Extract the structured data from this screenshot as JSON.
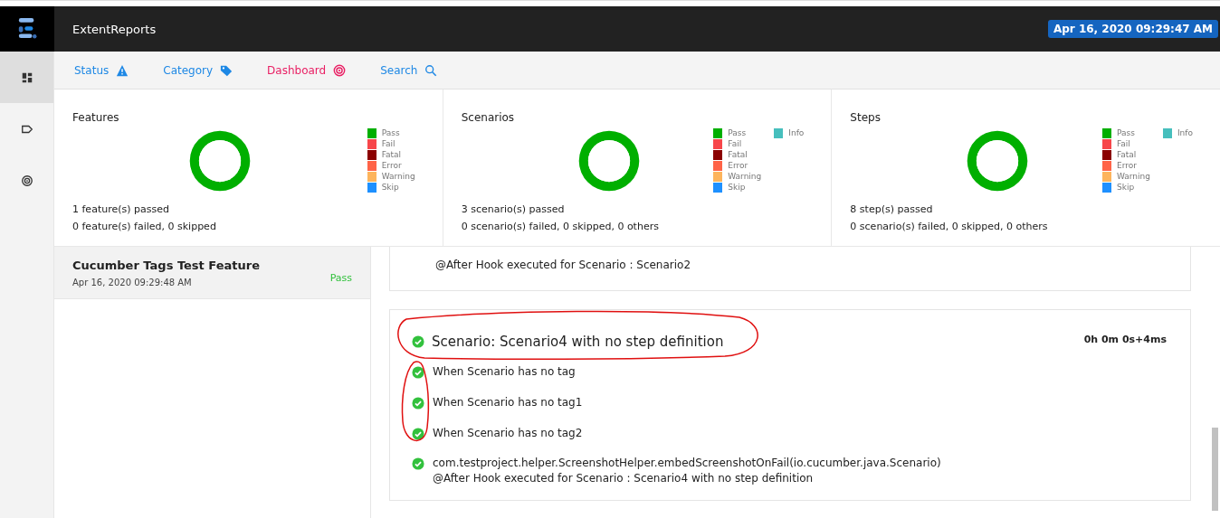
{
  "header": {
    "title": "ExtentReports",
    "timestamp": "Apr 16, 2020 09:29:47 AM"
  },
  "sidebar": {
    "items": [
      {
        "kind": "dashboard",
        "selected": true
      },
      {
        "kind": "tag",
        "selected": false
      },
      {
        "kind": "target",
        "selected": false
      }
    ]
  },
  "nav": [
    {
      "label": "Status",
      "kind": "warning",
      "selected": false
    },
    {
      "label": "Category",
      "kind": "tag",
      "selected": false
    },
    {
      "label": "Dashboard",
      "kind": "target",
      "selected": true
    },
    {
      "label": "Search",
      "kind": "search",
      "selected": false
    }
  ],
  "dashboard": [
    {
      "title": "Features",
      "chart_data": {
        "type": "donut",
        "categories": [
          "Pass",
          "Fail",
          "Fatal",
          "Error",
          "Warning",
          "Skip"
        ],
        "values": [
          100,
          0,
          0,
          0,
          0,
          0
        ]
      },
      "legend": [
        {
          "color": "#00af00"
        },
        {
          "color": "#f7464a"
        },
        {
          "color": "#8b0000"
        },
        {
          "color": "#ff6347"
        },
        {
          "color": "#fdb45c"
        },
        {
          "color": "#1e90ff"
        }
      ],
      "summary": [
        "**1** feature(s) passed",
        "**0** feature(s) failed, **0** skipped"
      ]
    },
    {
      "title": "Scenarios",
      "chart_data": {
        "type": "donut",
        "categories": [
          "Pass",
          "Fail",
          "Fatal",
          "Error",
          "Warning",
          "Skip",
          "Info"
        ],
        "values": [
          100,
          0,
          0,
          0,
          0,
          0,
          0
        ]
      },
      "legend": [
        {
          "color": "#00af00"
        },
        {
          "color": "#f7464a"
        },
        {
          "color": "#8b0000"
        },
        {
          "color": "#ff6347"
        },
        {
          "color": "#fdb45c"
        },
        {
          "color": "#1e90ff"
        },
        {
          "color": "#46bfbd"
        }
      ],
      "summary": [
        "**3** scenario(s) passed",
        "**0** scenario(s) failed, **0** skipped, **0** others"
      ]
    },
    {
      "title": "Steps",
      "chart_data": {
        "type": "donut",
        "categories": [
          "Pass",
          "Fail",
          "Fatal",
          "Error",
          "Warning",
          "Skip",
          "Info"
        ],
        "values": [
          100,
          0,
          0,
          0,
          0,
          0,
          0
        ]
      },
      "legend": [
        {
          "color": "#00af00"
        },
        {
          "color": "#f7464a"
        },
        {
          "color": "#8b0000"
        },
        {
          "color": "#ff6347"
        },
        {
          "color": "#fdb45c"
        },
        {
          "color": "#1e90ff"
        },
        {
          "color": "#46bfbd"
        }
      ],
      "summary": [
        "**8** step(s) passed",
        "**0** scenario(s) failed, **0** skipped, **0** others"
      ]
    }
  ],
  "tests": [
    {
      "name": "Cucumber Tags Test Feature",
      "time": "Apr 16, 2020 09:29:48 AM",
      "status": "Pass",
      "selected": true
    }
  ],
  "scenarios": [
    {
      "lines": [
        "@After Hook executed for Scenario : Scenario2"
      ]
    },
    {
      "title": "Scenario: Scenario4 with no step definition",
      "duration": "0h 0m 0s+4ms",
      "passed": true,
      "steps": [
        {
          "text": "When Scenario has no tag",
          "passed": true
        },
        {
          "text": "When Scenario has no tag1",
          "passed": true
        },
        {
          "text": "When Scenario has no tag2",
          "passed": true
        },
        {
          "passed": true,
          "lines": [
            "com.testproject.helper.ScreenshotHelper.embedScreenshotOnFail(io.cucumber.java.Scenario)",
            "@After Hook executed for Scenario : Scenario4 with no step definition"
          ]
        }
      ]
    }
  ]
}
